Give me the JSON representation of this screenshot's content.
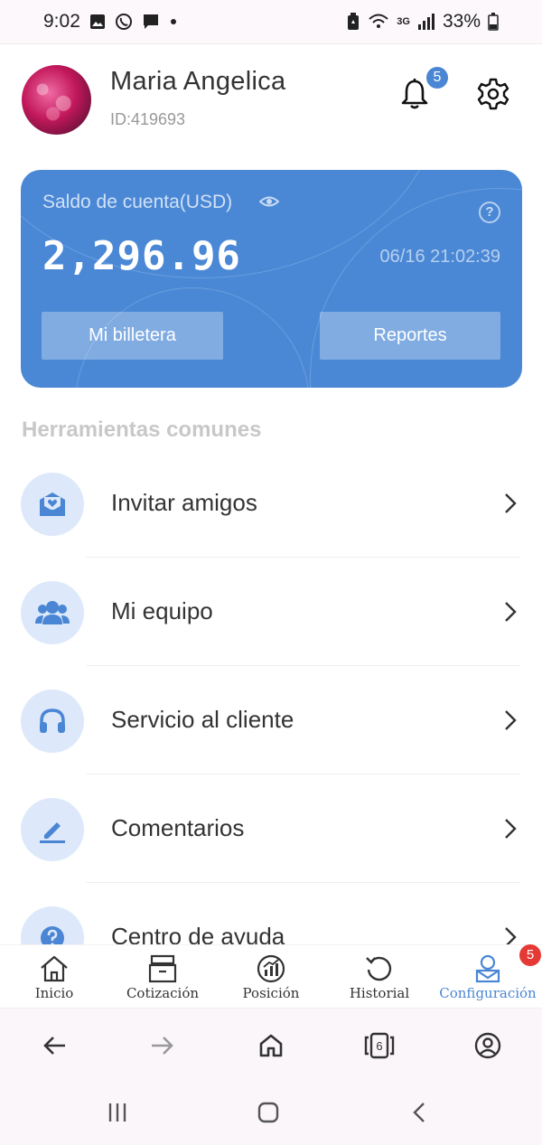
{
  "status_bar": {
    "time": "9:02",
    "network": "3G",
    "battery": "33%"
  },
  "profile": {
    "name": "Maria Angelica",
    "id": "ID:419693",
    "notification_count": "5"
  },
  "account_card": {
    "label": "Saldo de cuenta(USD)",
    "balance": "2,296.96",
    "timestamp": "06/16 21:02:39",
    "help_symbol": "?",
    "wallet_button": "Mi billetera",
    "reports_button": "Reportes"
  },
  "tools": {
    "title": "Herramientas comunes",
    "items": [
      {
        "label": "Invitar amigos",
        "icon": "envelope-heart-icon"
      },
      {
        "label": "Mi equipo",
        "icon": "team-icon"
      },
      {
        "label": "Servicio al cliente",
        "icon": "headset-icon"
      },
      {
        "label": "Comentarios",
        "icon": "pencil-icon"
      },
      {
        "label": "Centro de ayuda",
        "icon": "question-icon"
      }
    ]
  },
  "tabbar": {
    "tabs": [
      {
        "label": "Inicio",
        "icon": "home-icon"
      },
      {
        "label": "Cotización",
        "icon": "archive-icon"
      },
      {
        "label": "Posición",
        "icon": "chart-icon"
      },
      {
        "label": "Historial",
        "icon": "history-icon"
      },
      {
        "label": "Configuración",
        "icon": "user-settings-icon"
      }
    ],
    "active_index": 4,
    "config_badge": "5"
  },
  "browser_nav": {
    "tab_count": "6"
  },
  "colors": {
    "accent": "#4a88d6",
    "badge_red": "#e53935",
    "icon_bg": "#dde9fa"
  }
}
